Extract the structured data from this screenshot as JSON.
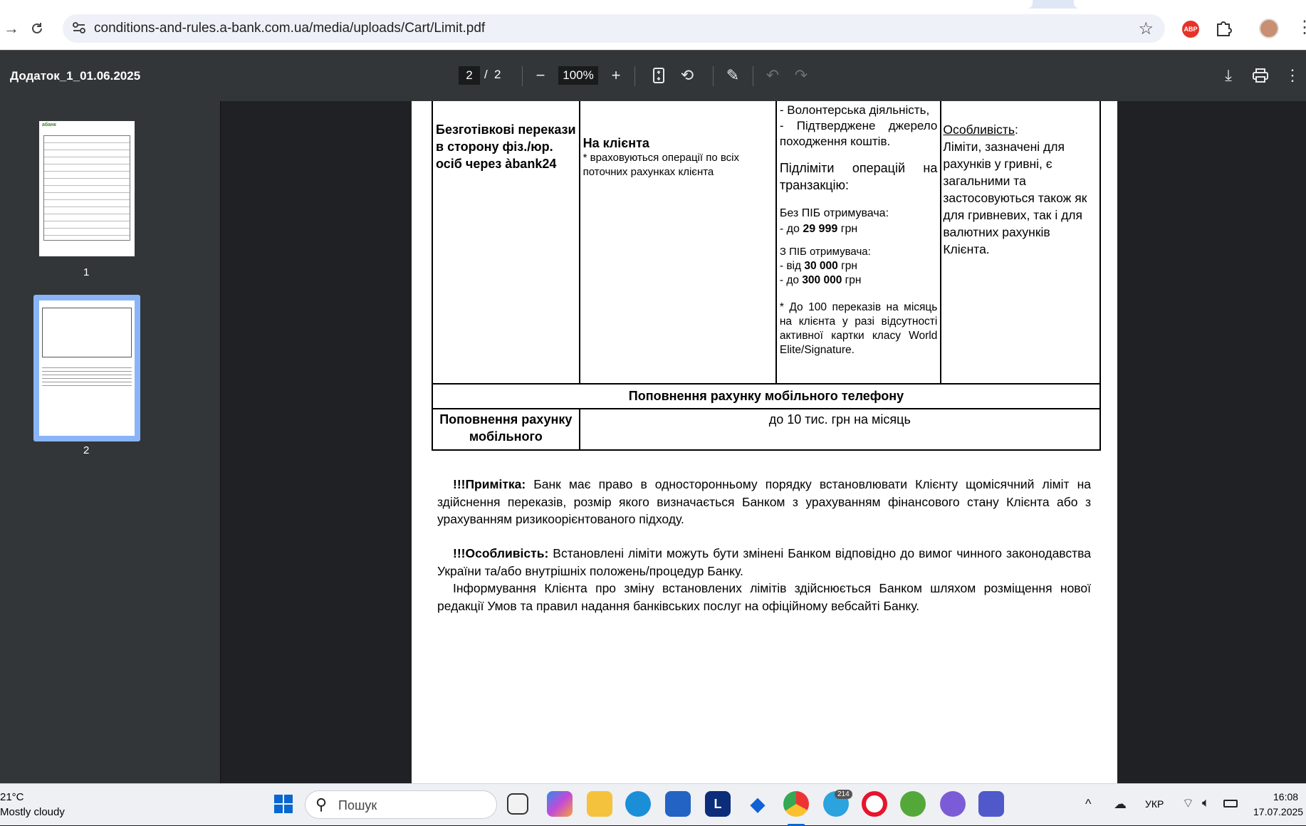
{
  "browser": {
    "url": "conditions-and-rules.a-bank.com.ua/media/uploads/Cart/Limit.pdf",
    "abp_label": "ABP"
  },
  "pdf_toolbar": {
    "title": "Додаток_1_01.06.2025",
    "current_page": "2",
    "page_separator": "/",
    "total_pages": "2",
    "zoom": "100%"
  },
  "sidebar": {
    "thumbnails": [
      {
        "label": "1",
        "logo": "абанк"
      },
      {
        "label": "2"
      }
    ]
  },
  "document": {
    "transfer_row": {
      "service": "Безготівкові перекази в сторону фіз./юр. осіб через àbank24",
      "target": "На клієнта",
      "target_note": "* враховуються операції по всіх поточних рахунках клієнта",
      "conditions": {
        "line1": "- Волонтерська діяльність,",
        "line2": "- Підтверджене джерело походження коштів.",
        "sublimits_title": "Підліміти операцій на транзакцію:",
        "no_name_title": "Без ПІБ отримувача:",
        "no_name_prefix": "- до ",
        "no_name_value": "29 999",
        "no_name_suffix": " грн",
        "with_name_title": "З ПІБ отримувача:",
        "from_prefix": "- від ",
        "from_value": "30 000",
        "from_suffix": " грн",
        "to_prefix": "-  до ",
        "to_value": "300 000",
        "to_suffix": " грн",
        "note": "* До 100 переказів на місяць на клієнта у разі відсутності активної картки класу World Elite/Signature."
      },
      "feature_title": "Особливість",
      "feature_colon": ":",
      "feature_text": "Ліміти, зазначені для рахунків у гривні, є загальними та застосовуються також як для гривневих, так і для валютних рахунків Клієнта."
    },
    "section_header": "Поповнення рахунку мобільного телефону",
    "mobile_row": {
      "service": "Поповнення рахунку мобільного",
      "limit": "до 10 тис. грн на місяць"
    },
    "note_label": "!!!Примітка:",
    "note_text": " Банк має право в односторонньому порядку встановлювати Клієнту щомісячний ліміт на здійснення переказів, розмір якого визначається Банком з урахуванням фінансового стану Клієнта або з урахуванням ризикоорієнтованого підходу.",
    "feature_label": "!!!Особливість:",
    "feature_body": " Встановлені ліміти можуть бути змінені Банком відповідно до вимог чинного законодавства України та/або внутрішніх положень/процедур Банку.",
    "info_text": "Інформування Клієнта про зміну встановлених лімітів здійснюється Банком шляхом розміщення нової редакції Умов та правил надання банківських послуг на офіційному вебсайті Банку."
  },
  "taskbar": {
    "weather_temp": "21°C",
    "weather_desc": "Mostly cloudy",
    "search_placeholder": "Пошук",
    "telegram_badge": "214",
    "app_letter": "L",
    "language": "УКР",
    "time": "16:08",
    "date": "17.07.2025"
  },
  "colors": {
    "toolbar": "#323639",
    "viewer_bg": "#202124",
    "section_green": "#3a8a25",
    "thumb_selected": "#8ab4f8"
  }
}
